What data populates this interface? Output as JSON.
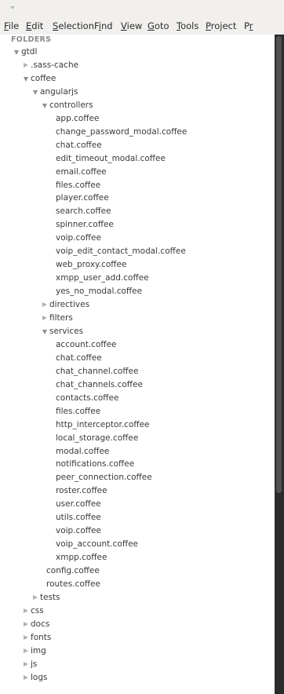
{
  "menu": [
    {
      "pre": "",
      "ul": "F",
      "post": "ile"
    },
    {
      "pre": "",
      "ul": "E",
      "post": "dit"
    },
    {
      "pre": "",
      "ul": "S",
      "post": "election"
    },
    {
      "pre": "F",
      "ul": "i",
      "post": "nd"
    },
    {
      "pre": "",
      "ul": "V",
      "post": "iew"
    },
    {
      "pre": "",
      "ul": "G",
      "post": "oto"
    },
    {
      "pre": "",
      "ul": "T",
      "post": "ools"
    },
    {
      "pre": "",
      "ul": "P",
      "post": "roject"
    },
    {
      "pre": "P",
      "ul": "r",
      "post": ""
    }
  ],
  "sidebar": {
    "title": "FOLDERS",
    "tree": [
      {
        "label": "gtdl",
        "depth": 0,
        "type": "folder",
        "open": true
      },
      {
        "label": ".sass-cache",
        "depth": 1,
        "type": "folder",
        "open": false
      },
      {
        "label": "coffee",
        "depth": 1,
        "type": "folder",
        "open": true
      },
      {
        "label": "angularjs",
        "depth": 2,
        "type": "folder",
        "open": true
      },
      {
        "label": "controllers",
        "depth": 3,
        "type": "folder",
        "open": true
      },
      {
        "label": "app.coffee",
        "depth": 4,
        "type": "file"
      },
      {
        "label": "change_password_modal.coffee",
        "depth": 4,
        "type": "file"
      },
      {
        "label": "chat.coffee",
        "depth": 4,
        "type": "file"
      },
      {
        "label": "edit_timeout_modal.coffee",
        "depth": 4,
        "type": "file"
      },
      {
        "label": "email.coffee",
        "depth": 4,
        "type": "file"
      },
      {
        "label": "files.coffee",
        "depth": 4,
        "type": "file"
      },
      {
        "label": "player.coffee",
        "depth": 4,
        "type": "file"
      },
      {
        "label": "search.coffee",
        "depth": 4,
        "type": "file"
      },
      {
        "label": "spinner.coffee",
        "depth": 4,
        "type": "file"
      },
      {
        "label": "voip.coffee",
        "depth": 4,
        "type": "file"
      },
      {
        "label": "voip_edit_contact_modal.coffee",
        "depth": 4,
        "type": "file"
      },
      {
        "label": "web_proxy.coffee",
        "depth": 4,
        "type": "file"
      },
      {
        "label": "xmpp_user_add.coffee",
        "depth": 4,
        "type": "file"
      },
      {
        "label": "yes_no_modal.coffee",
        "depth": 4,
        "type": "file"
      },
      {
        "label": "directives",
        "depth": 3,
        "type": "folder",
        "open": false
      },
      {
        "label": "filters",
        "depth": 3,
        "type": "folder",
        "open": false
      },
      {
        "label": "services",
        "depth": 3,
        "type": "folder",
        "open": true
      },
      {
        "label": "account.coffee",
        "depth": 4,
        "type": "file"
      },
      {
        "label": "chat.coffee",
        "depth": 4,
        "type": "file"
      },
      {
        "label": "chat_channel.coffee",
        "depth": 4,
        "type": "file"
      },
      {
        "label": "chat_channels.coffee",
        "depth": 4,
        "type": "file"
      },
      {
        "label": "contacts.coffee",
        "depth": 4,
        "type": "file"
      },
      {
        "label": "files.coffee",
        "depth": 4,
        "type": "file"
      },
      {
        "label": "http_interceptor.coffee",
        "depth": 4,
        "type": "file"
      },
      {
        "label": "local_storage.coffee",
        "depth": 4,
        "type": "file"
      },
      {
        "label": "modal.coffee",
        "depth": 4,
        "type": "file"
      },
      {
        "label": "notifications.coffee",
        "depth": 4,
        "type": "file"
      },
      {
        "label": "peer_connection.coffee",
        "depth": 4,
        "type": "file"
      },
      {
        "label": "roster.coffee",
        "depth": 4,
        "type": "file"
      },
      {
        "label": "user.coffee",
        "depth": 4,
        "type": "file"
      },
      {
        "label": "utils.coffee",
        "depth": 4,
        "type": "file"
      },
      {
        "label": "voip.coffee",
        "depth": 4,
        "type": "file"
      },
      {
        "label": "voip_account.coffee",
        "depth": 4,
        "type": "file"
      },
      {
        "label": "xmpp.coffee",
        "depth": 4,
        "type": "file"
      },
      {
        "label": "config.coffee",
        "depth": 3,
        "type": "file"
      },
      {
        "label": "routes.coffee",
        "depth": 3,
        "type": "file"
      },
      {
        "label": "tests",
        "depth": 2,
        "type": "folder",
        "open": false
      },
      {
        "label": "css",
        "depth": 1,
        "type": "folder",
        "open": false
      },
      {
        "label": "docs",
        "depth": 1,
        "type": "folder",
        "open": false
      },
      {
        "label": "fonts",
        "depth": 1,
        "type": "folder",
        "open": false
      },
      {
        "label": "img",
        "depth": 1,
        "type": "folder",
        "open": false
      },
      {
        "label": "js",
        "depth": 1,
        "type": "folder",
        "open": false
      },
      {
        "label": "logs",
        "depth": 1,
        "type": "folder",
        "open": false
      }
    ]
  }
}
